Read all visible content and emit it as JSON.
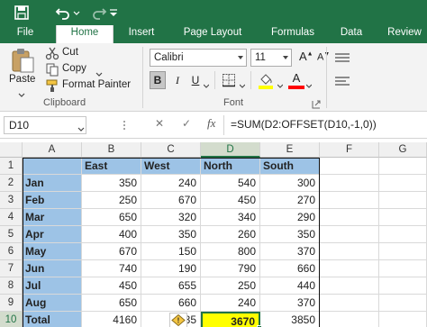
{
  "ribbon_tabs": [
    "File",
    "Home",
    "Insert",
    "Page Layout",
    "Formulas",
    "Data",
    "Review"
  ],
  "active_tab": "Home",
  "clipboard": {
    "paste_label": "Paste",
    "cut_label": "Cut",
    "copy_label": "Copy",
    "format_painter_label": "Format Painter",
    "group_label": "Clipboard"
  },
  "font": {
    "family": "Calibri",
    "size": "11",
    "grow_label": "A",
    "shrink_label": "A",
    "bold_label": "B",
    "italic_label": "I",
    "underline_label": "U",
    "font_color_label": "A",
    "group_label": "Font"
  },
  "formula_bar": {
    "name_box": "D10",
    "cancel": "✕",
    "enter": "✓",
    "fx": "fx",
    "formula": "=SUM(D2:OFFSET(D10,-1,0))"
  },
  "columns": [
    "A",
    "B",
    "C",
    "D",
    "E",
    "F",
    "G"
  ],
  "selected_column": "D",
  "selected_row": "10",
  "rows": [
    {
      "n": "1",
      "a": "",
      "b": "East",
      "c": "West",
      "d": "North",
      "e": "South"
    },
    {
      "n": "2",
      "a": "Jan",
      "b": "350",
      "c": "240",
      "d": "540",
      "e": "300"
    },
    {
      "n": "3",
      "a": "Feb",
      "b": "250",
      "c": "670",
      "d": "450",
      "e": "270"
    },
    {
      "n": "4",
      "a": "Mar",
      "b": "650",
      "c": "320",
      "d": "340",
      "e": "290"
    },
    {
      "n": "5",
      "a": "Apr",
      "b": "400",
      "c": "350",
      "d": "260",
      "e": "350"
    },
    {
      "n": "6",
      "a": "May",
      "b": "670",
      "c": "150",
      "d": "800",
      "e": "370"
    },
    {
      "n": "7",
      "a": "Jun",
      "b": "740",
      "c": "190",
      "d": "790",
      "e": "660"
    },
    {
      "n": "8",
      "a": "Jul",
      "b": "450",
      "c": "655",
      "d": "250",
      "e": "440"
    },
    {
      "n": "9",
      "a": "Aug",
      "b": "650",
      "c": "660",
      "d": "240",
      "e": "370"
    },
    {
      "n": "10",
      "a": "Total",
      "b": "4160",
      "c": "35",
      "d": "3670",
      "e": "3850"
    }
  ],
  "colors": {
    "excel_green": "#217346",
    "header_fill": "#9dc3e6",
    "highlight": "#ffff00"
  }
}
